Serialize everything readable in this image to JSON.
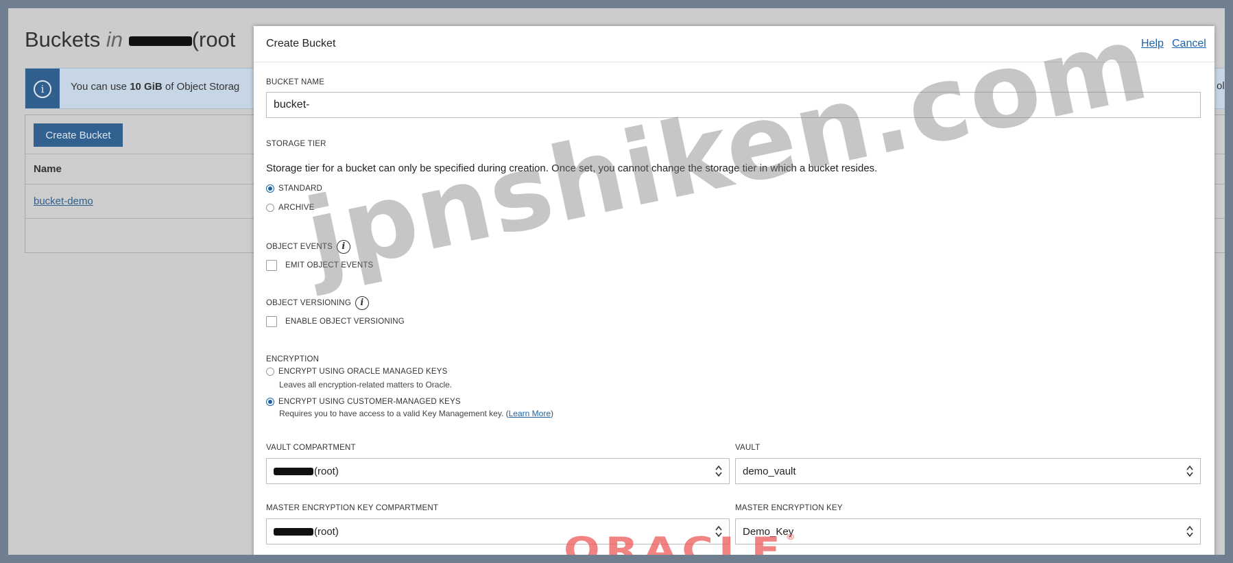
{
  "background": {
    "title_prefix": "Buckets",
    "title_in": "in",
    "title_suffix": "(root",
    "info_text_prefix": "You can use ",
    "info_text_bold": "10 GiB",
    "info_text_suffix": " of Object Storag",
    "info_right_fragment": "ol",
    "create_button": "Create Bucket",
    "column_name": "Name",
    "bucket_link": "bucket-demo"
  },
  "modal": {
    "title": "Create Bucket",
    "help_link": "Help",
    "cancel_link": "Cancel",
    "bucket_name": {
      "label": "BUCKET NAME",
      "value": "bucket-"
    },
    "storage_tier": {
      "label": "STORAGE TIER",
      "description": "Storage tier for a bucket can only be specified during creation. Once set, you cannot change the storage tier in which a bucket resides.",
      "options": [
        {
          "label": "STANDARD",
          "selected": true
        },
        {
          "label": "ARCHIVE",
          "selected": false
        }
      ]
    },
    "object_events": {
      "label": "OBJECT EVENTS",
      "checkbox_label": "EMIT OBJECT EVENTS",
      "checked": false
    },
    "object_versioning": {
      "label": "OBJECT VERSIONING",
      "checkbox_label": "ENABLE OBJECT VERSIONING",
      "checked": false
    },
    "encryption": {
      "label": "ENCRYPTION",
      "options": [
        {
          "label": "ENCRYPT USING ORACLE MANAGED KEYS",
          "sub": "Leaves all encryption-related matters to Oracle.",
          "selected": false
        },
        {
          "label": "ENCRYPT USING CUSTOMER-MANAGED KEYS",
          "sub": "Requires you to have access to a valid Key Management key. (",
          "selected": true
        }
      ],
      "learn_more": "Learn More",
      "learn_more_close": ")"
    },
    "vault_compartment": {
      "label": "VAULT COMPARTMENT",
      "value": "(root)"
    },
    "vault": {
      "label": "VAULT",
      "value": "demo_vault"
    },
    "key_compartment": {
      "label": "MASTER ENCRYPTION KEY COMPARTMENT",
      "value": "(root)"
    },
    "master_key": {
      "label": "MASTER ENCRYPTION KEY",
      "value": "Demo_Key"
    }
  },
  "watermark": {
    "site": "jpnshiken.com",
    "logo": "ORACLE",
    "logo_mark": "®"
  },
  "colors": {
    "accent": "#1a63a8",
    "backdrop": "#cccccc",
    "frame": "#6f7f90",
    "watermark_logo": "#ec5a5a"
  }
}
